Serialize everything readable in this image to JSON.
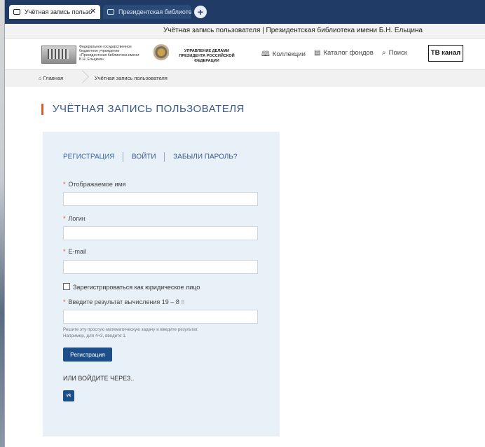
{
  "browser": {
    "tabs": [
      {
        "label": "Учётная запись пользо",
        "active": true
      },
      {
        "label": "Президентская библиоте",
        "active": false
      }
    ],
    "new_tab_symbol": "+",
    "close_symbol": "✕",
    "window_title": "Учётная запись пользователя | Президентская библиотека имени Б.Н. Ельцина"
  },
  "header": {
    "org_text": "Федеральное государственное бюджетное учреждение «Президентская библиотека имени Б.Н. Ельцина»",
    "udp_text": "УПРАВЛЕНИЕ ДЕЛАМИ ПРЕЗИДЕНТА РОССИЙСКОЙ ФЕДЕРАЦИИ",
    "nav": {
      "collections": "Коллекции",
      "catalog": "Каталог фондов",
      "search": "Поиск"
    },
    "tv_button": "ТВ канал"
  },
  "breadcrumb": {
    "home": "Главная",
    "current": "Учётная запись пользователя"
  },
  "page": {
    "title": "УЧЁТНАЯ ЗАПИСЬ ПОЛЬЗОВАТЕЛЯ"
  },
  "form": {
    "tabs": {
      "register": "РЕГИСТРАЦИЯ",
      "login": "ВОЙТИ",
      "forgot": "ЗАБЫЛИ ПАРОЛЬ?"
    },
    "required_mark": "*",
    "fields": {
      "display_name": "Отображаемое имя",
      "login": "Логин",
      "email": "E-mail",
      "captcha": "Введите результат вычисления 19 – 8 ="
    },
    "legal_entity_checkbox": "Зарегистрироваться как юридическое лицо",
    "hint_line1": "Решите эту простую математическую задачу и введите результат.",
    "hint_line2": "Например, для 4+3, введите 1.",
    "submit": "Регистрация",
    "or_login_via": "ИЛИ ВОЙДИТЕ ЧЕРЕЗ..",
    "vk_label": "vk"
  },
  "colors": {
    "tabbar": "#1f3b66",
    "accent_blue": "#1c4f8a",
    "title_blue": "#3a5a8c",
    "accent_orange": "#e05a2a",
    "panel_bg": "#e8f0f8"
  }
}
